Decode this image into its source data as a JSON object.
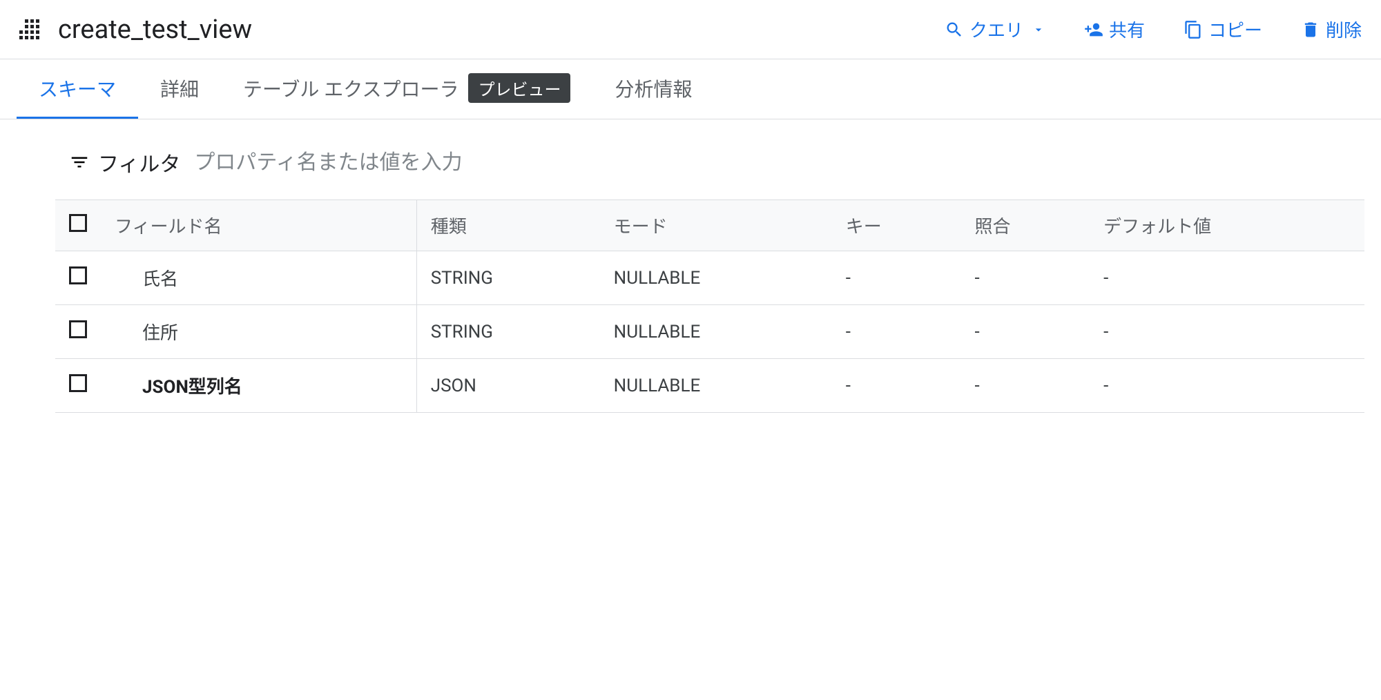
{
  "header": {
    "title": "create_test_view",
    "toolbar": {
      "query_label": "クエリ",
      "share_label": "共有",
      "copy_label": "コピー",
      "delete_label": "削除"
    }
  },
  "tabs": [
    {
      "label": "スキーマ",
      "active": true
    },
    {
      "label": "詳細",
      "active": false
    },
    {
      "label": "テーブル エクスプローラ",
      "badge": "プレビュー",
      "active": false
    },
    {
      "label": "分析情報",
      "active": false
    }
  ],
  "filter": {
    "label": "フィルタ",
    "placeholder": "プロパティ名または値を入力"
  },
  "schema": {
    "columns": {
      "field_name": "フィールド名",
      "type": "種類",
      "mode": "モード",
      "key": "キー",
      "collation": "照合",
      "default_value": "デフォルト値"
    },
    "rows": [
      {
        "field_name": "氏名",
        "type": "STRING",
        "mode": "NULLABLE",
        "key": "-",
        "collation": "-",
        "default_value": "-",
        "bold": false
      },
      {
        "field_name": "住所",
        "type": "STRING",
        "mode": "NULLABLE",
        "key": "-",
        "collation": "-",
        "default_value": "-",
        "bold": false
      },
      {
        "field_name": "JSON型列名",
        "type": "JSON",
        "mode": "NULLABLE",
        "key": "-",
        "collation": "-",
        "default_value": "-",
        "bold": true
      }
    ]
  }
}
